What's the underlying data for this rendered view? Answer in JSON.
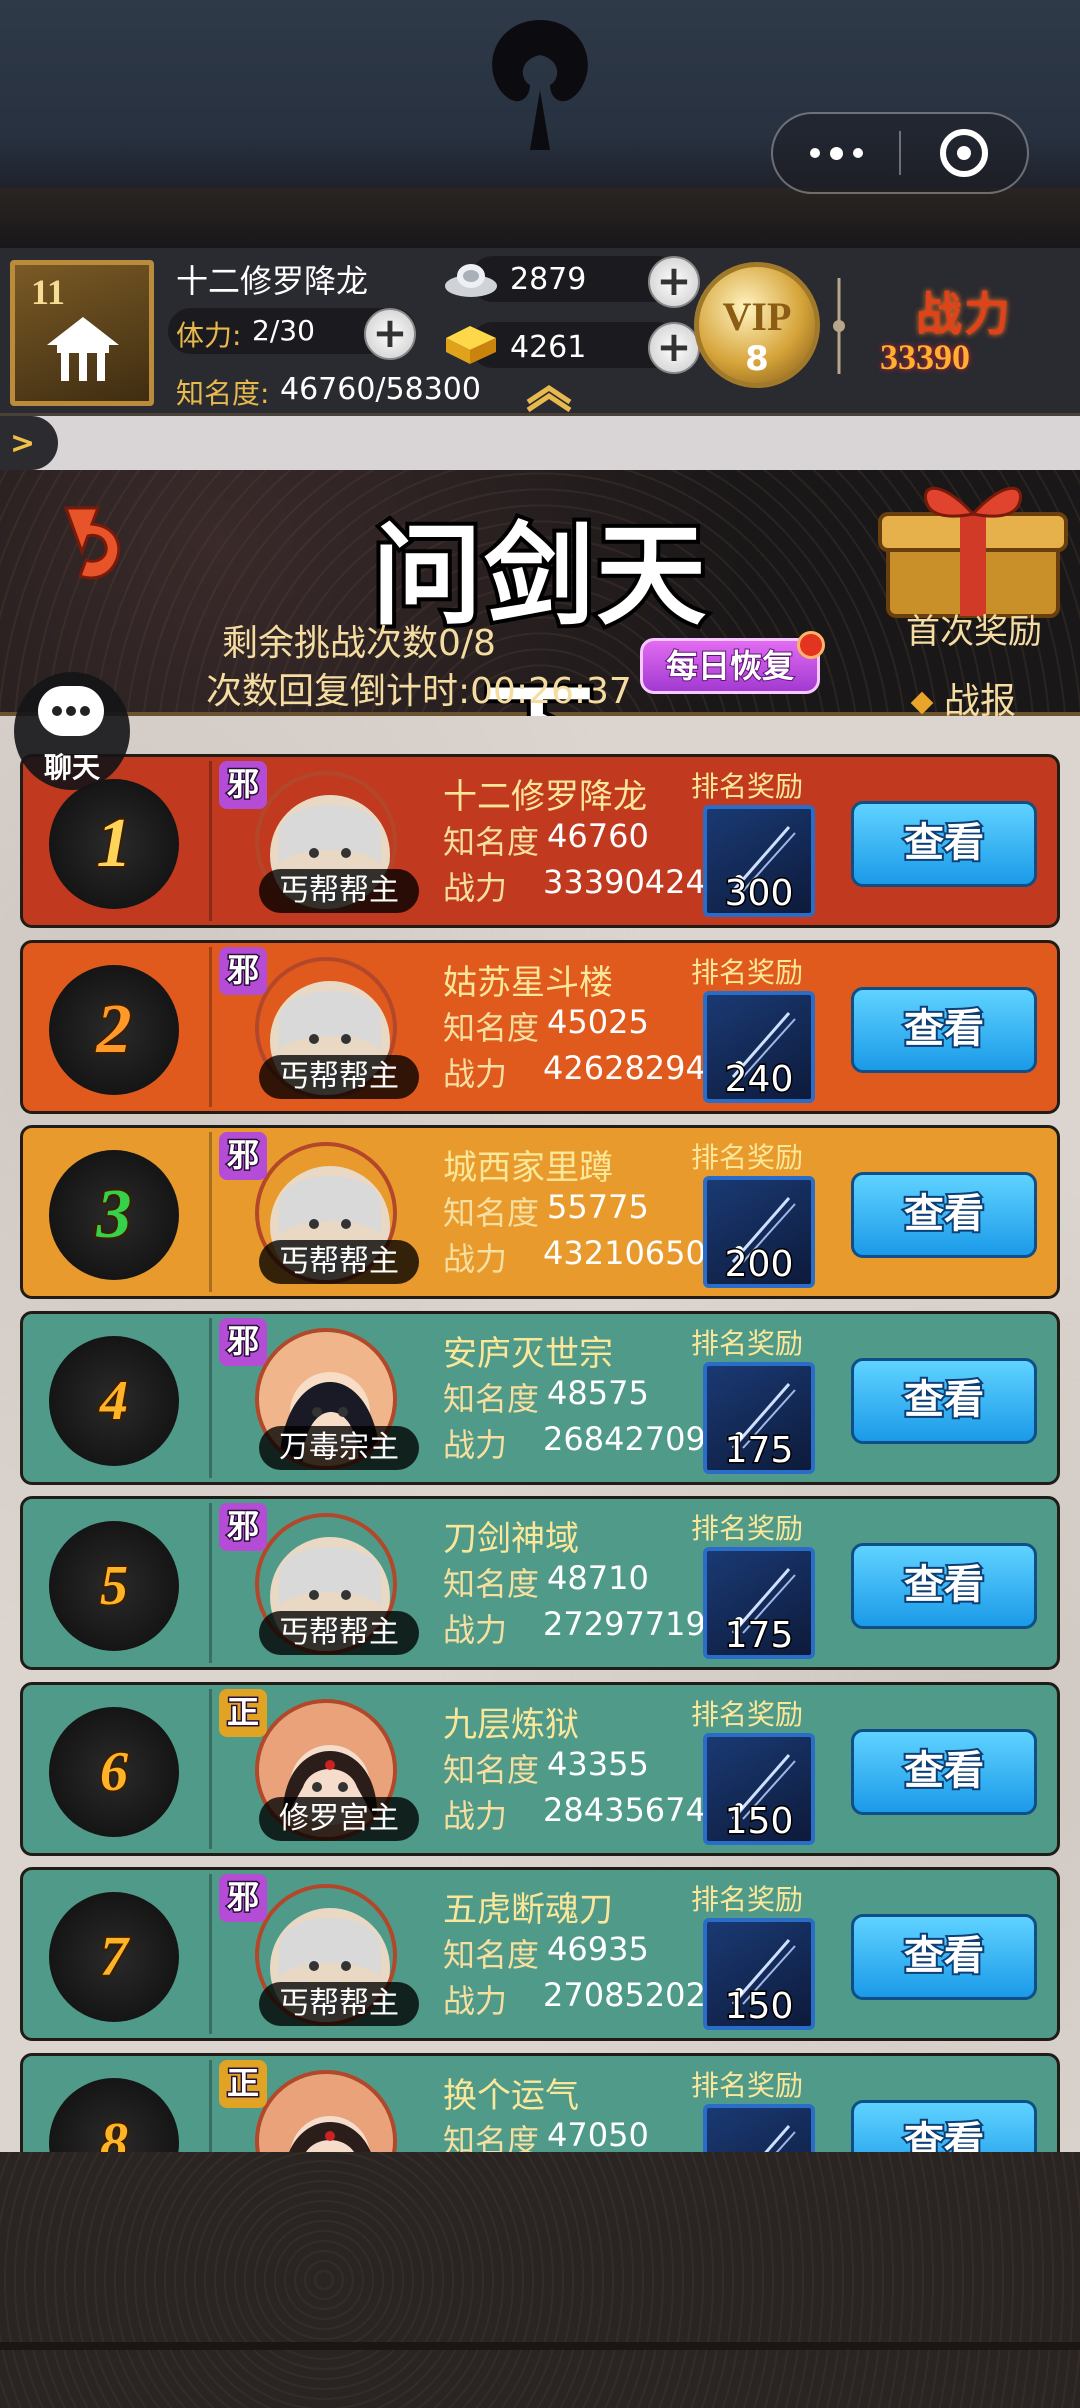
{
  "player": {
    "level": "11",
    "name": "十二修罗降龙",
    "stamina_label": "体力:",
    "stamina": "2/30",
    "fame_label": "知名度:",
    "fame": "46760/58300",
    "silver": "2879",
    "gold": "4261",
    "vip_text": "VIP",
    "vip_level": "8",
    "power_label": "战力",
    "power": "33390"
  },
  "banner": {
    "title": "问剑天下",
    "remaining_label": "剩余挑战次数0/8",
    "timer_label": "次数回复倒计时:00:26:37",
    "daily_button": "每日恢复",
    "first_reward": "首次奖励",
    "report": "战报"
  },
  "chat": {
    "label": "聊天"
  },
  "list": {
    "fame_label": "知名度",
    "power_label": "战力",
    "reward_label": "排名奖励",
    "view_label": "查看",
    "rows": [
      {
        "rank": "1",
        "faction": "邪",
        "role": "丐帮帮主",
        "guild": "十二修罗降龙",
        "fame": "46760",
        "power": "33390424",
        "reward": "300",
        "bg": "#c13a1f",
        "rank_color": "#ffd35a",
        "portrait": "old"
      },
      {
        "rank": "2",
        "faction": "邪",
        "role": "丐帮帮主",
        "guild": "姑苏星斗楼",
        "fame": "45025",
        "power": "42628294",
        "reward": "240",
        "bg": "#e05a1e",
        "rank_color": "#ff9a2a",
        "portrait": "old"
      },
      {
        "rank": "3",
        "faction": "邪",
        "role": "丐帮帮主",
        "guild": "城西家里蹲",
        "fame": "55775",
        "power": "43210650",
        "reward": "200",
        "bg": "#e99a2c",
        "rank_color": "#36d04a",
        "portrait": "old"
      },
      {
        "rank": "4",
        "faction": "邪",
        "role": "万毒宗主",
        "guild": "安庐灭世宗",
        "fame": "48575",
        "power": "26842709",
        "reward": "175",
        "bg": "#4f9a88",
        "rank_color": "#ffb427",
        "portrait": "woman"
      },
      {
        "rank": "5",
        "faction": "邪",
        "role": "丐帮帮主",
        "guild": "刀剑神域",
        "fame": "48710",
        "power": "27297719",
        "reward": "175",
        "bg": "#4f9a88",
        "rank_color": "#ffb427",
        "portrait": "old"
      },
      {
        "rank": "6",
        "faction": "正",
        "role": "修罗宫主",
        "guild": "九层炼狱",
        "fame": "43355",
        "power": "28435674",
        "reward": "150",
        "bg": "#4f9a88",
        "rank_color": "#ffb427",
        "portrait": "lady"
      },
      {
        "rank": "7",
        "faction": "邪",
        "role": "丐帮帮主",
        "guild": "五虎断魂刀",
        "fame": "46935",
        "power": "27085202",
        "reward": "150",
        "bg": "#4f9a88",
        "rank_color": "#ffb427",
        "portrait": "old"
      },
      {
        "rank": "8",
        "faction": "正",
        "role": "",
        "guild": "换个运气",
        "fame": "47050",
        "power": "",
        "reward": "",
        "bg": "#4f9a88",
        "rank_color": "#ffb427",
        "portrait": "lady"
      }
    ]
  },
  "colors": {
    "evil_badge": "#b44cd6",
    "righteous_badge": "#e0a324"
  },
  "icons": [
    "more-dots-icon",
    "close-circle-icon",
    "silver-ingot-icon",
    "gold-ingot-icon",
    "plus-icon",
    "back-arrow-icon",
    "gift-chest-icon",
    "chat-bubble-icon",
    "sword-reward-icon"
  ]
}
